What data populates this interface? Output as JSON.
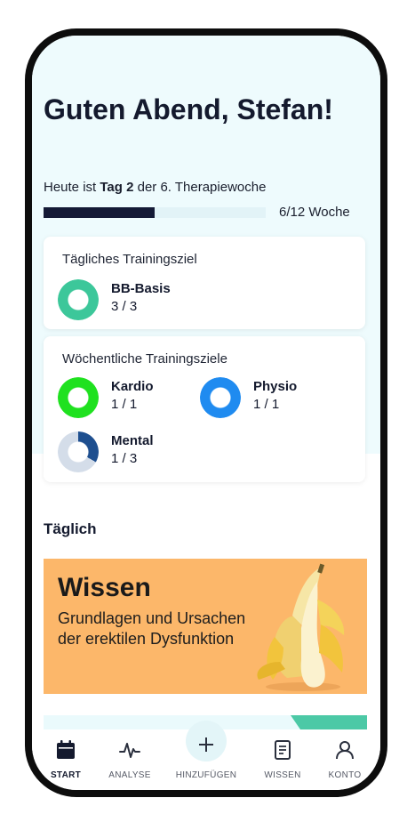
{
  "greeting": "Guten Abend, Stefan!",
  "status": {
    "prefix": "Heute ist ",
    "day": "Tag 2",
    "suffix": " der 6. Therapiewoche"
  },
  "progress": {
    "label": "6/12 Woche",
    "fraction": 0.5
  },
  "daily_goal": {
    "title": "Tägliches Trainingsziel",
    "items": [
      {
        "name": "BB-Basis",
        "count": "3 / 3",
        "fraction": 1.0,
        "color": "#3cc79a"
      }
    ]
  },
  "weekly_goals": {
    "title": "Wöchentliche Trainingsziele",
    "items": [
      {
        "name": "Kardio",
        "count": "1 / 1",
        "fraction": 1.0,
        "color": "#1fe11f"
      },
      {
        "name": "Physio",
        "count": "1 / 1",
        "fraction": 1.0,
        "color": "#1f8bf0"
      },
      {
        "name": "Mental",
        "count": "1 / 3",
        "fraction": 0.3333,
        "color": "#1e4f8f",
        "track_color": "#d4dde9"
      }
    ]
  },
  "section": {
    "title": "Täglich"
  },
  "banner": {
    "title": "Wissen",
    "text": "Grundlagen und Ursachen der erektilen Dysfunktion",
    "color": "#fcb76a",
    "image": "banana-illustration"
  },
  "nav": [
    {
      "label": "START",
      "icon": "calendar-icon",
      "active": true
    },
    {
      "label": "ANALYSE",
      "icon": "pulse-icon",
      "active": false
    },
    {
      "label": "HINZUFÜGEN",
      "icon": "plus-icon",
      "active": false
    },
    {
      "label": "WISSEN",
      "icon": "document-icon",
      "active": false
    },
    {
      "label": "KONTO",
      "icon": "person-icon",
      "active": false
    }
  ]
}
